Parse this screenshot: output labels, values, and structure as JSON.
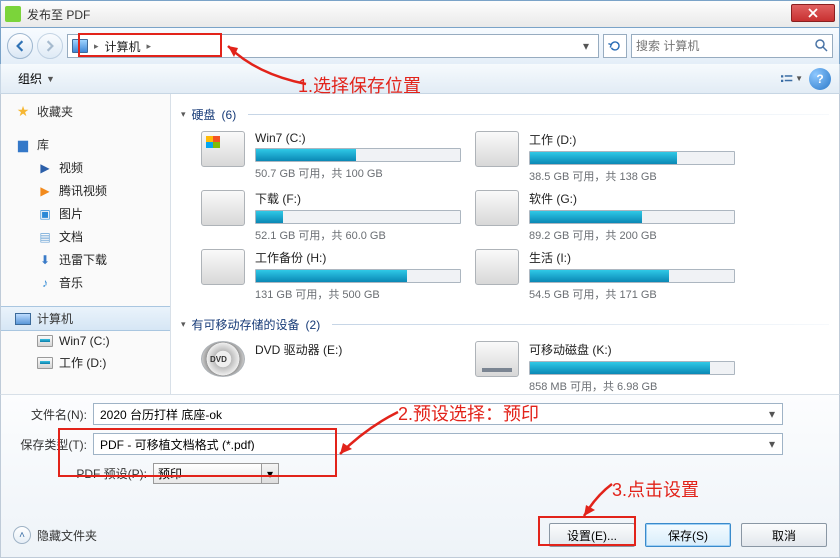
{
  "title": "发布至 PDF",
  "breadcrumb": {
    "root": "计算机"
  },
  "search": {
    "placeholder": "搜索 计算机"
  },
  "toolbar": {
    "organize": "组织"
  },
  "sidebar": {
    "favorites": "收藏夹",
    "libraries": "库",
    "items": [
      "视频",
      "腾讯视频",
      "图片",
      "文档",
      "迅雷下载",
      "音乐"
    ],
    "computer": "计算机",
    "drives": [
      "Win7 (C:)",
      "工作 (D:)"
    ]
  },
  "sections": {
    "hdd": {
      "label": "硬盘",
      "count": "(6)"
    },
    "removable": {
      "label": "有可移动存储的设备",
      "count": "(2)"
    }
  },
  "drives": [
    {
      "name": "Win7 (C:)",
      "stat": "50.7 GB 可用，共 100 GB",
      "pct": 49
    },
    {
      "name": "工作 (D:)",
      "stat": "38.5 GB 可用，共 138 GB",
      "pct": 72
    },
    {
      "name": "下载 (F:)",
      "stat": "52.1 GB 可用，共 60.0 GB",
      "pct": 13
    },
    {
      "name": "软件 (G:)",
      "stat": "89.2 GB 可用，共 200 GB",
      "pct": 55
    },
    {
      "name": "工作备份 (H:)",
      "stat": "131 GB 可用，共 500 GB",
      "pct": 74
    },
    {
      "name": "生活 (I:)",
      "stat": "54.5 GB 可用，共 171 GB",
      "pct": 68
    }
  ],
  "removable": [
    {
      "name": "DVD 驱动器 (E:)",
      "stat": ""
    },
    {
      "name": "可移动磁盘 (K:)",
      "stat": "858 MB 可用，共 6.98 GB",
      "pct": 88
    }
  ],
  "form": {
    "filename_label": "文件名(N):",
    "filename": "2020 台历打样 底座-ok",
    "type_label": "保存类型(T):",
    "type": "PDF - 可移植文档格式 (*.pdf)",
    "preset_label": "PDF 预设(P):",
    "preset": "预印"
  },
  "footer": {
    "hide": "隐藏文件夹",
    "settings": "设置(E)...",
    "save": "保存(S)",
    "cancel": "取消"
  },
  "anno": {
    "a1": "1.选择保存位置",
    "a2": "2.预设选择：预印",
    "a3": "3.点击设置"
  }
}
